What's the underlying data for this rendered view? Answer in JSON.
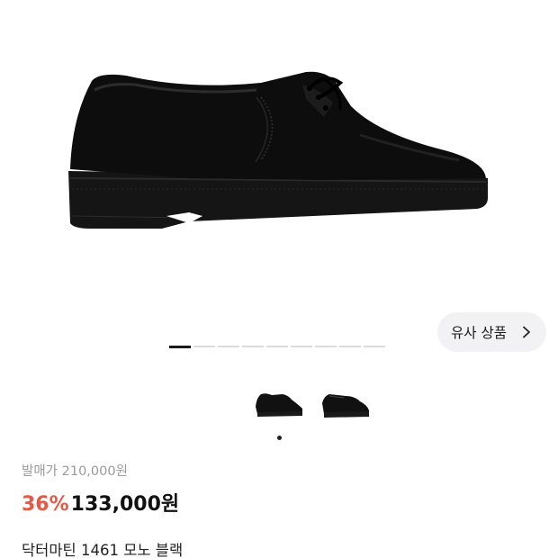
{
  "product": {
    "image_alt": "black derby shoe",
    "original_price_label": "발매가 210,000원",
    "discount": "36%",
    "price": "133,000원",
    "name": "닥터마틴 1461 모노 블랙"
  },
  "similar_button": {
    "label": "유사 상품",
    "icon": "chevron-right-icon"
  },
  "gallery": {
    "total_pages": 9,
    "current_page": 1,
    "thumbnail_count": 2,
    "selected_thumbnail": 1
  },
  "colors": {
    "discount": "#e55a45",
    "muted_text": "#9a9a9a",
    "pill_bg": "#f2f2f4"
  }
}
